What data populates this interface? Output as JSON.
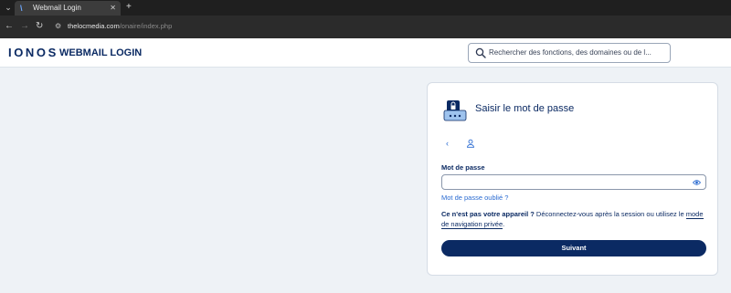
{
  "browser": {
    "tab_title": "Webmail Login",
    "new_tab_label": "+",
    "close_label": "✕",
    "tab_list_label": "⌄",
    "url_host": "thelocmedia.com",
    "url_path": "/onaire/index.php"
  },
  "header": {
    "logo": "IONOS",
    "product_title": "WEBMAIL LOGIN",
    "search_text": "Rechercher des fonctions, des domaines ou de l..."
  },
  "card": {
    "title": "Saisir le mot de passe",
    "back_label": "‹",
    "password_label": "Mot de passe",
    "password_value": "",
    "forgot_link": "Mot de passe oublié ?",
    "hint_bold": "Ce n'est pas votre appareil ?",
    "hint_text": " Déconnectez-vous après la session ou utilisez le ",
    "hint_link": "mode de navigation privée",
    "hint_end": ".",
    "submit_label": "Suivant"
  },
  "colors": {
    "brand": "#0b2a63",
    "link": "#2a6bd1",
    "background": "#eef2f6"
  },
  "icons": [
    "tab-list-icon",
    "ionos-favicon-icon",
    "close-icon",
    "back-arrow-icon",
    "forward-arrow-icon",
    "reload-icon",
    "site-settings-icon",
    "search-icon",
    "lock-bag-icon",
    "chevron-left-icon",
    "user-icon",
    "eye-icon"
  ]
}
